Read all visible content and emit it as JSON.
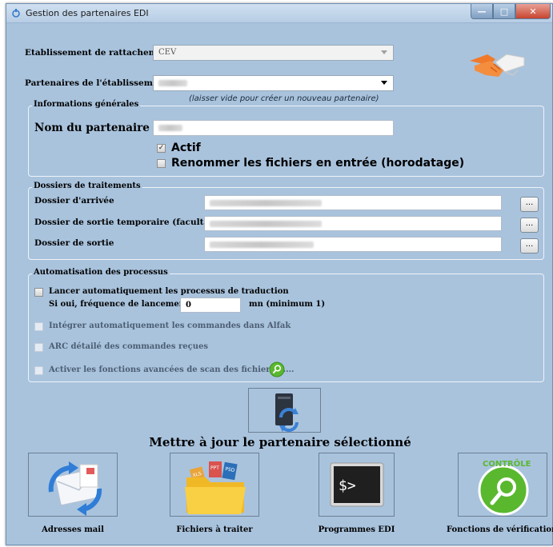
{
  "window": {
    "title": "Gestion des partenaires EDI",
    "buttons": {
      "minimize": "—",
      "maximize": "□",
      "close": "✕"
    }
  },
  "etablissement": {
    "label": "Etablissement de rattachement",
    "value": "CEV"
  },
  "partenaires": {
    "label": "Partenaires de l'établissement",
    "hint": "(laisser vide pour créer un nouveau partenaire)"
  },
  "infos": {
    "title": "Informations générales",
    "nom_label": "Nom du partenaire",
    "actif_label": "Actif",
    "actif_checked": true,
    "renommer_label": "Renommer les fichiers en entrée (horodatage)",
    "renommer_checked": false
  },
  "dossiers": {
    "title": "Dossiers de traitements",
    "arrivee_label": "Dossier d'arrivée",
    "sortie_temp_label": "Dossier de sortie temporaire (facultatif)",
    "sortie_label": "Dossier de sortie",
    "browse_label": "..."
  },
  "automatisation": {
    "title": "Automatisation des processus",
    "lancer_label": "Lancer automatiquement les processus de traduction",
    "frequence_label": "Si oui, fréquence de lancement :",
    "frequence_value": "0",
    "frequence_unit": "mn (minimum 1)",
    "integrer_label": "Intégrer automatiquement les commandes dans Alfak",
    "arc_label": "ARC détailé des commandes reçues",
    "scan_label": "Activer les fonctions avancées de scan des fichiers......."
  },
  "update": {
    "label": "Mettre à jour le partenaire sélectionné"
  },
  "tiles": {
    "adresses": "Adresses mail",
    "fichiers": "Fichiers à traiter",
    "programmes": "Programmes EDI",
    "verification": "Fonctions de vérification",
    "controle_text": "CONTRÔLE",
    "terminal_text": "$>",
    "doc_tags": [
      "XLS",
      "PPT",
      "PSD"
    ]
  },
  "colors": {
    "background": "#a9c3dd",
    "accent_green": "#5ab82f",
    "handshake_orange": "#f07a2a"
  }
}
